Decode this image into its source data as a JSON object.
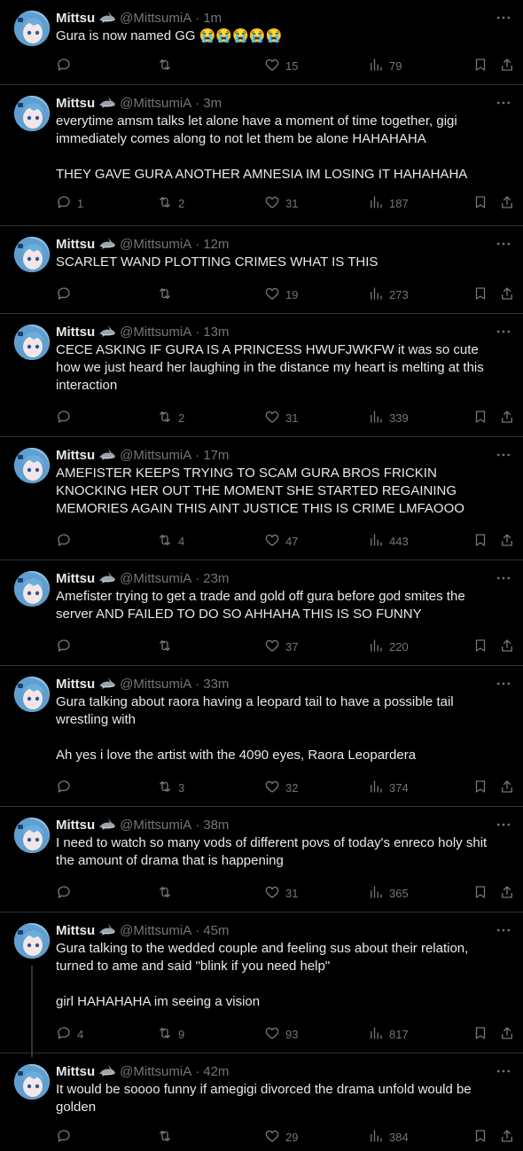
{
  "user": {
    "name": "Mittsu",
    "handle": "@MittsumiA",
    "dot": "·"
  },
  "tweets": [
    {
      "time": "1m",
      "text": "Gura is now named GG 😭😭😭😭😭",
      "replies": "",
      "retweets": "",
      "likes": "15",
      "views": "79"
    },
    {
      "time": "3m",
      "text": "everytime amsm talks let alone have a moment of time together, gigi immediately comes along to not let them be alone HAHAHAHA\n\nTHEY GAVE GURA ANOTHER AMNESIA IM LOSING IT HAHAHAHA",
      "replies": "1",
      "retweets": "2",
      "likes": "31",
      "views": "187"
    },
    {
      "time": "12m",
      "text": "SCARLET WAND PLOTTING CRIMES WHAT IS THIS",
      "replies": "",
      "retweets": "",
      "likes": "19",
      "views": "273"
    },
    {
      "time": "13m",
      "text": "CECE ASKING IF GURA IS A PRINCESS HWUFJWKFW it was so cute how we just heard her laughing in the distance my heart is melting at this interaction",
      "replies": "",
      "retweets": "2",
      "likes": "31",
      "views": "339"
    },
    {
      "time": "17m",
      "text": "AMEFISTER KEEPS TRYING TO SCAM GURA BROS FRICKIN KNOCKING HER OUT THE MOMENT SHE STARTED REGAINING MEMORIES AGAIN THIS AINT JUSTICE THIS IS CRIME LMFAOOO",
      "replies": "",
      "retweets": "4",
      "likes": "47",
      "views": "443"
    },
    {
      "time": "23m",
      "text": "Amefister trying to get a trade and gold off gura before god smites the server AND FAILED TO DO SO AHHAHA THIS IS SO FUNNY",
      "replies": "",
      "retweets": "",
      "likes": "37",
      "views": "220"
    },
    {
      "time": "33m",
      "text": "Gura talking about raora having a leopard tail to have a possible tail wrestling with\n\nAh yes i love the artist with the 4090 eyes, Raora Leopardera",
      "replies": "",
      "retweets": "3",
      "likes": "32",
      "views": "374"
    },
    {
      "time": "38m",
      "text": "I need to watch so many vods of different povs of today's enreco holy shit the amount of drama that is happening",
      "replies": "",
      "retweets": "",
      "likes": "31",
      "views": "365"
    },
    {
      "time": "45m",
      "text": "Gura talking to the wedded couple and feeling sus about their relation, turned to ame and said \"blink if you need help\"\n\ngirl HAHAHAHA im seeing a vision",
      "replies": "4",
      "retweets": "9",
      "likes": "93",
      "views": "817"
    },
    {
      "time": "42m",
      "text": "It would be soooo funny if amegigi divorced the drama unfold would be golden",
      "replies": "",
      "retweets": "",
      "likes": "29",
      "views": "384"
    }
  ],
  "colors": {
    "background": "#000000",
    "text": "#e7e9ea",
    "muted": "#71767b",
    "divider": "#2f3336",
    "avatar_hair": "#8fc3e6"
  },
  "icons": [
    "more-icon",
    "shark-emoji-icon",
    "reply-icon",
    "retweet-icon",
    "like-icon",
    "views-icon",
    "bookmark-icon",
    "share-icon"
  ]
}
